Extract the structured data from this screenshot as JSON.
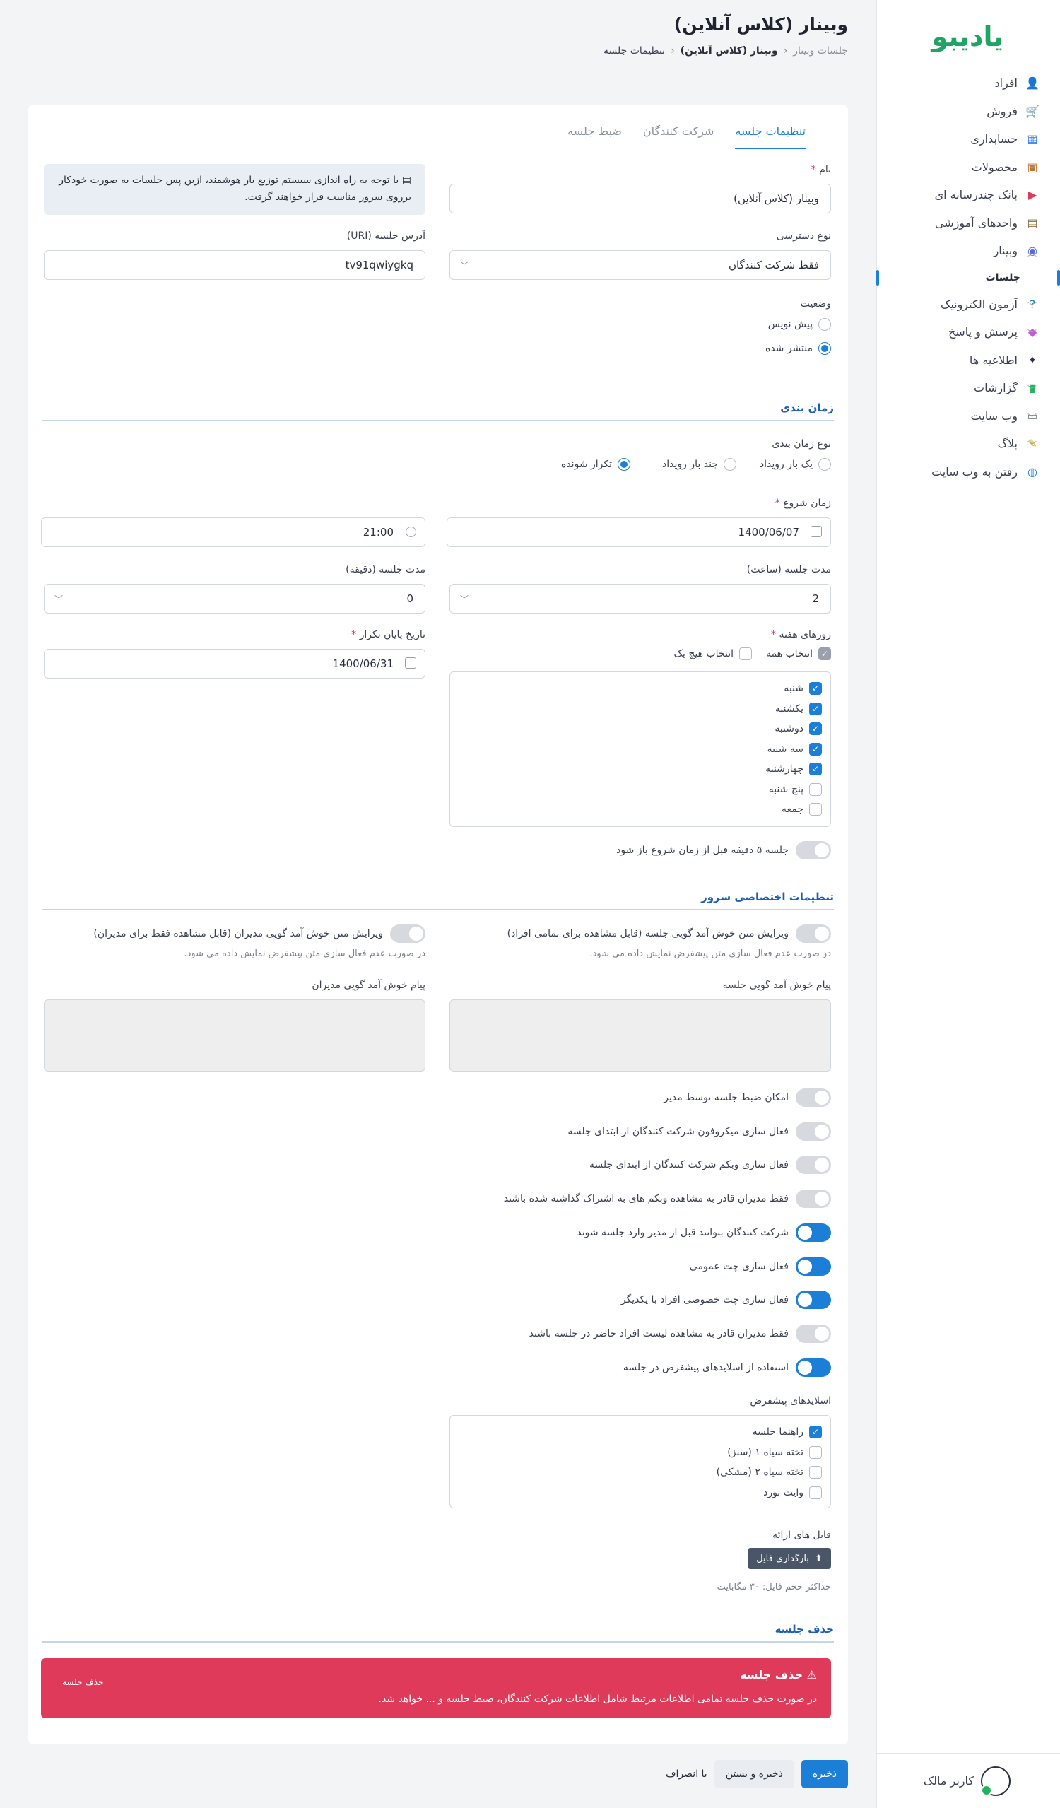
{
  "brand": {
    "logo_text": "یادیبو"
  },
  "sidebar": {
    "items": [
      {
        "label": "افراد",
        "icon": "people-icon",
        "chevron": false
      },
      {
        "label": "فروش",
        "icon": "cart-icon",
        "chevron": true
      },
      {
        "label": "حسابداری",
        "icon": "calculator-icon",
        "chevron": true
      },
      {
        "label": "محصولات",
        "icon": "box-icon",
        "chevron": true
      },
      {
        "label": "بانک چندرسانه ای",
        "icon": "media-icon",
        "chevron": false
      },
      {
        "label": "واحدهای آموزشی",
        "icon": "training-icon",
        "chevron": false
      },
      {
        "label": "وبینار",
        "icon": "webinar-icon",
        "chevron": true
      }
    ],
    "sub_item": "جلسات",
    "items_after": [
      {
        "label": "آزمون الکترونیک",
        "icon": "question-icon",
        "chevron": true
      },
      {
        "label": "پرسش و پاسخ",
        "icon": "chat-icon",
        "chevron": true
      },
      {
        "label": "اطلاعیه ها",
        "icon": "megaphone-icon",
        "chevron": false
      },
      {
        "label": "گزارشات",
        "icon": "chart-icon",
        "chevron": true
      },
      {
        "label": "وب سایت",
        "icon": "website-icon",
        "chevron": true
      },
      {
        "label": "بلاگ",
        "icon": "blog-icon",
        "chevron": true
      },
      {
        "label": "رفتن به وب سایت",
        "icon": "globe-icon",
        "chevron": false
      }
    ],
    "user_name": "کاربر مالک"
  },
  "header": {
    "title": "وبینار (کلاس آنلاین)",
    "breadcrumb": [
      "جلسات وبینار",
      "وبینار (کلاس آنلاین)",
      "تنظیمات جلسه"
    ]
  },
  "tabs": [
    "تنظیمات جلسه",
    "شرکت کنندگان",
    "ضبط جلسه"
  ],
  "form": {
    "name_label": "نام",
    "name_value": "وبینار (کلاس آنلاین)",
    "info_text": "با توجه به راه اندازی سیستم توزیع بار هوشمند، ازین پس جلسات به صورت خودکار برروی سرور مناسب قرار خواهند گرفت.",
    "access_label": "نوع دسترسی",
    "access_value": "فقط شرکت کنندگان",
    "uri_label": "آدرس جلسه (URI)",
    "uri_value": "tv91qwiygkq",
    "status_label": "وضعیت",
    "status_options": [
      "پیش نویس",
      "منتشر شده"
    ],
    "status_selected": 1
  },
  "schedule": {
    "section_title": "زمان بندی",
    "type_label": "نوع زمان بندی",
    "type_options": [
      "یک بار رویداد",
      "چند بار رویداد",
      "تکرار شونده"
    ],
    "type_selected": 2,
    "start_label": "زمان شروع",
    "start_date": "1400/06/07",
    "start_time": "21:00",
    "duration_hours_label": "مدت جلسه (ساعت)",
    "duration_hours": "2",
    "duration_minutes_label": "مدت جلسه (دقیقه)",
    "duration_minutes": "0",
    "weekdays_label": "روزهای هفته",
    "select_all": "انتخاب همه",
    "select_none": "انتخاب هیچ یک",
    "weekdays": [
      {
        "label": "شنبه",
        "checked": true
      },
      {
        "label": "یکشنبه",
        "checked": true
      },
      {
        "label": "دوشنبه",
        "checked": true
      },
      {
        "label": "سه شنبه",
        "checked": true
      },
      {
        "label": "چهارشنبه",
        "checked": true
      },
      {
        "label": "پنج شنبه",
        "checked": false
      },
      {
        "label": "جمعه",
        "checked": false
      }
    ],
    "repeat_end_label": "تاریخ پایان تکرار",
    "repeat_end": "1400/06/31",
    "early_open_label": "جلسه ۵ دقیقه قبل از زمان شروع باز شود"
  },
  "server": {
    "section_title": "تنظیمات اختصاصی سرور",
    "welcome_all_label": "ویرایش متن خوش آمد گویی جلسه (قابل مشاهده برای تمامی افراد)",
    "welcome_all_hint": "در صورت عدم فعال سازی متن پیشفرض نمایش داده می شود.",
    "welcome_mod_label": "ویرایش متن خوش آمد گویی مدیران (قابل مشاهده فقط برای مدیران)",
    "welcome_mod_hint": "در صورت عدم فعال سازی متن پیشفرض نمایش داده می شود.",
    "welcome_msg_label": "پیام خوش آمد گویی جلسه",
    "welcome_mod_msg_label": "پیام خوش آمد گویی مدیران",
    "toggles": [
      {
        "label": "امکان ضبط جلسه توسط مدیر",
        "on": false
      },
      {
        "label": "فعال سازی میکروفون شرکت کنندگان از ابتدای جلسه",
        "on": false
      },
      {
        "label": "فعال سازی وبکم شرکت کنندگان از ابتدای جلسه",
        "on": false
      },
      {
        "label": "فقط مدیران قادر به مشاهده وبکم های به اشتراک گذاشته شده باشند",
        "on": false
      },
      {
        "label": "شرکت کنندگان بتوانند قبل از مدیر وارد جلسه شوند",
        "on": true
      },
      {
        "label": "فعال سازی چت عمومی",
        "on": true
      },
      {
        "label": "فعال سازی چت خصوصی افراد با یکدیگر",
        "on": true
      },
      {
        "label": "فقط مدیران قادر به مشاهده لیست افراد حاضر در جلسه باشند",
        "on": false
      },
      {
        "label": "استفاده از اسلایدهای پیشفرض در جلسه",
        "on": true
      }
    ],
    "slides_label": "اسلایدهای پیشفرض",
    "slides": [
      {
        "label": "راهنما جلسه",
        "checked": true
      },
      {
        "label": "تخته سیاه ۱ (سبز)",
        "checked": false
      },
      {
        "label": "تخته سیاه ۲ (مشکی)",
        "checked": false
      },
      {
        "label": "وایت بورد",
        "checked": false
      }
    ],
    "files_label": "فایل های ارائه",
    "upload_label": "بارگذاری فایل",
    "max_size": "حداکثر حجم فایل: ۳۰ مگابایت"
  },
  "delete": {
    "section_title": "حذف جلسه",
    "box_title": "حذف جلسه",
    "box_text": "در صورت حذف جلسه تمامی اطلاعات مرتبط شامل اطلاعات شرکت کنندگان، ضبط جلسه و ... خواهد شد.",
    "box_button": "حذف جلسه"
  },
  "footer": {
    "save": "ذخیره",
    "save_close": "ذخیره و بستن",
    "or_cancel": "یا انصراف"
  },
  "colors": {
    "accent": "#1b7fd8",
    "danger": "#e03a5a",
    "brand": "#20a464"
  }
}
